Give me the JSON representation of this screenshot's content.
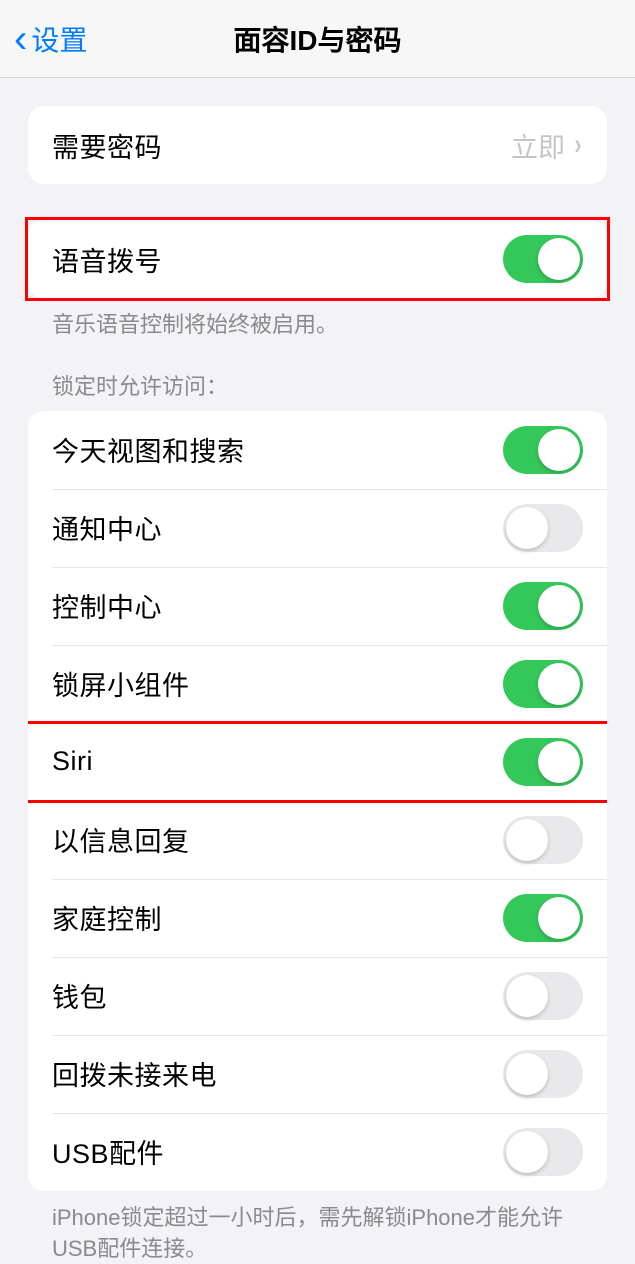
{
  "header": {
    "back_label": "设置",
    "title": "面容ID与密码"
  },
  "passcode_section": {
    "label": "需要密码",
    "value": "立即"
  },
  "voice_dial": {
    "label": "语音拨号",
    "on": true,
    "footer": "音乐语音控制将始终被启用。"
  },
  "lock_access": {
    "header": "锁定时允许访问：",
    "items": [
      {
        "label": "今天视图和搜索",
        "on": true
      },
      {
        "label": "通知中心",
        "on": false
      },
      {
        "label": "控制中心",
        "on": true
      },
      {
        "label": "锁屏小组件",
        "on": true
      },
      {
        "label": "Siri",
        "on": true
      },
      {
        "label": "以信息回复",
        "on": false
      },
      {
        "label": "家庭控制",
        "on": true
      },
      {
        "label": "钱包",
        "on": false
      },
      {
        "label": "回拨未接来电",
        "on": false
      },
      {
        "label": "USB配件",
        "on": false
      }
    ],
    "footer": "iPhone锁定超过一小时后，需先解锁iPhone才能允许USB配件连接。"
  }
}
